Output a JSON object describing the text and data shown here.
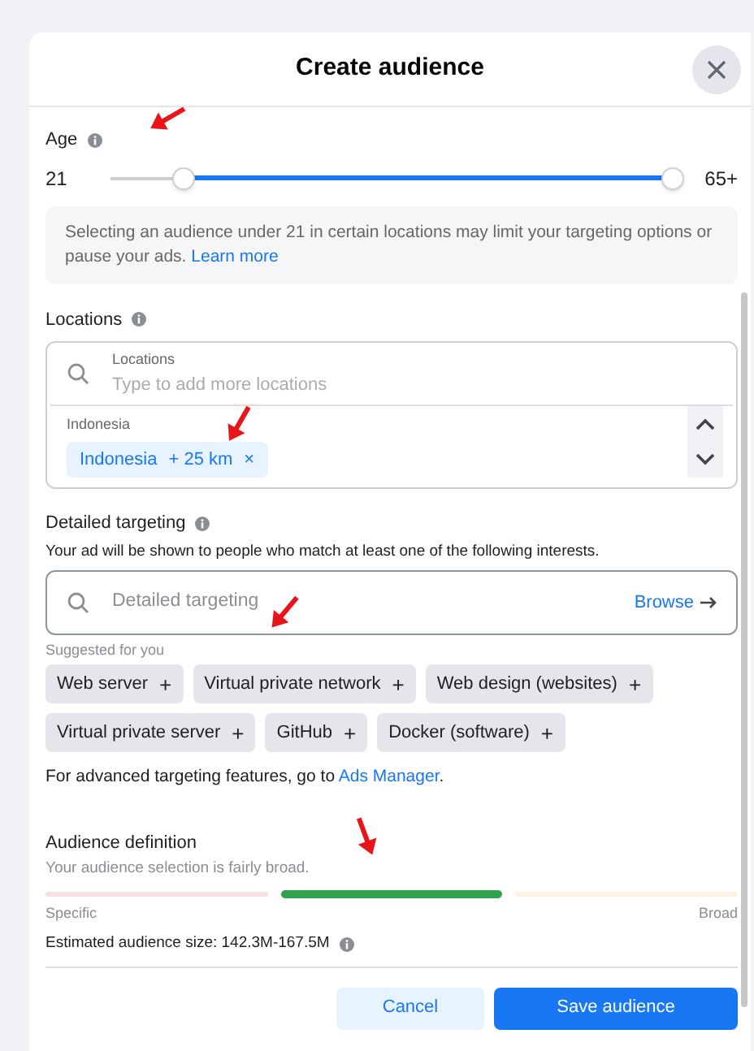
{
  "dialog": {
    "title": "Create audience"
  },
  "age": {
    "label": "Age",
    "min_label": "21",
    "max_label": "65+",
    "thumbs": [
      {
        "level": 0.13
      },
      {
        "level": 1
      }
    ],
    "notice": "Selecting an audience under 21 in certain locations may limit your targeting options or pause your ads.",
    "notice_link": "Learn more"
  },
  "locations": {
    "label": "Locations",
    "field_label": "Locations",
    "placeholder": "Type to add more locations",
    "group_label": "Indonesia",
    "tags": [
      {
        "name": "Indonesia",
        "radius": "+ 25 km",
        "remove": "×"
      }
    ]
  },
  "detailed_targeting": {
    "label": "Detailed targeting",
    "description": "Your ad will be shown to people who match at least one of the following interests.",
    "placeholder": "Detailed targeting",
    "browse": "Browse",
    "suggested_label": "Suggested for you",
    "suggestions": [
      {
        "label": "Web server",
        "add": "+"
      },
      {
        "label": "Virtual private network",
        "add": "+"
      },
      {
        "label": "Web design (websites)",
        "add": "+"
      },
      {
        "label": "Virtual private server",
        "add": "+"
      },
      {
        "label": "GitHub",
        "add": "+"
      },
      {
        "label": "Docker (software)",
        "add": "+"
      }
    ],
    "footnote": "For advanced targeting features, go to",
    "footnote_link": "Ads Manager",
    "footnote_end": "."
  },
  "audience_definition": {
    "label": "Audience definition",
    "description": "Your audience selection is fairly broad.",
    "segments": [
      {
        "color": "#f8dfe2",
        "selected": false
      },
      {
        "color": "#31a24c",
        "selected": true
      },
      {
        "color": "#fdf1e2",
        "selected": false
      }
    ],
    "left_label": "Specific",
    "right_label": "Broad",
    "estimate": "Estimated audience size: 142.3M-167.5M"
  },
  "buttons": {
    "cancel": "Cancel",
    "save": "Save audience"
  }
}
